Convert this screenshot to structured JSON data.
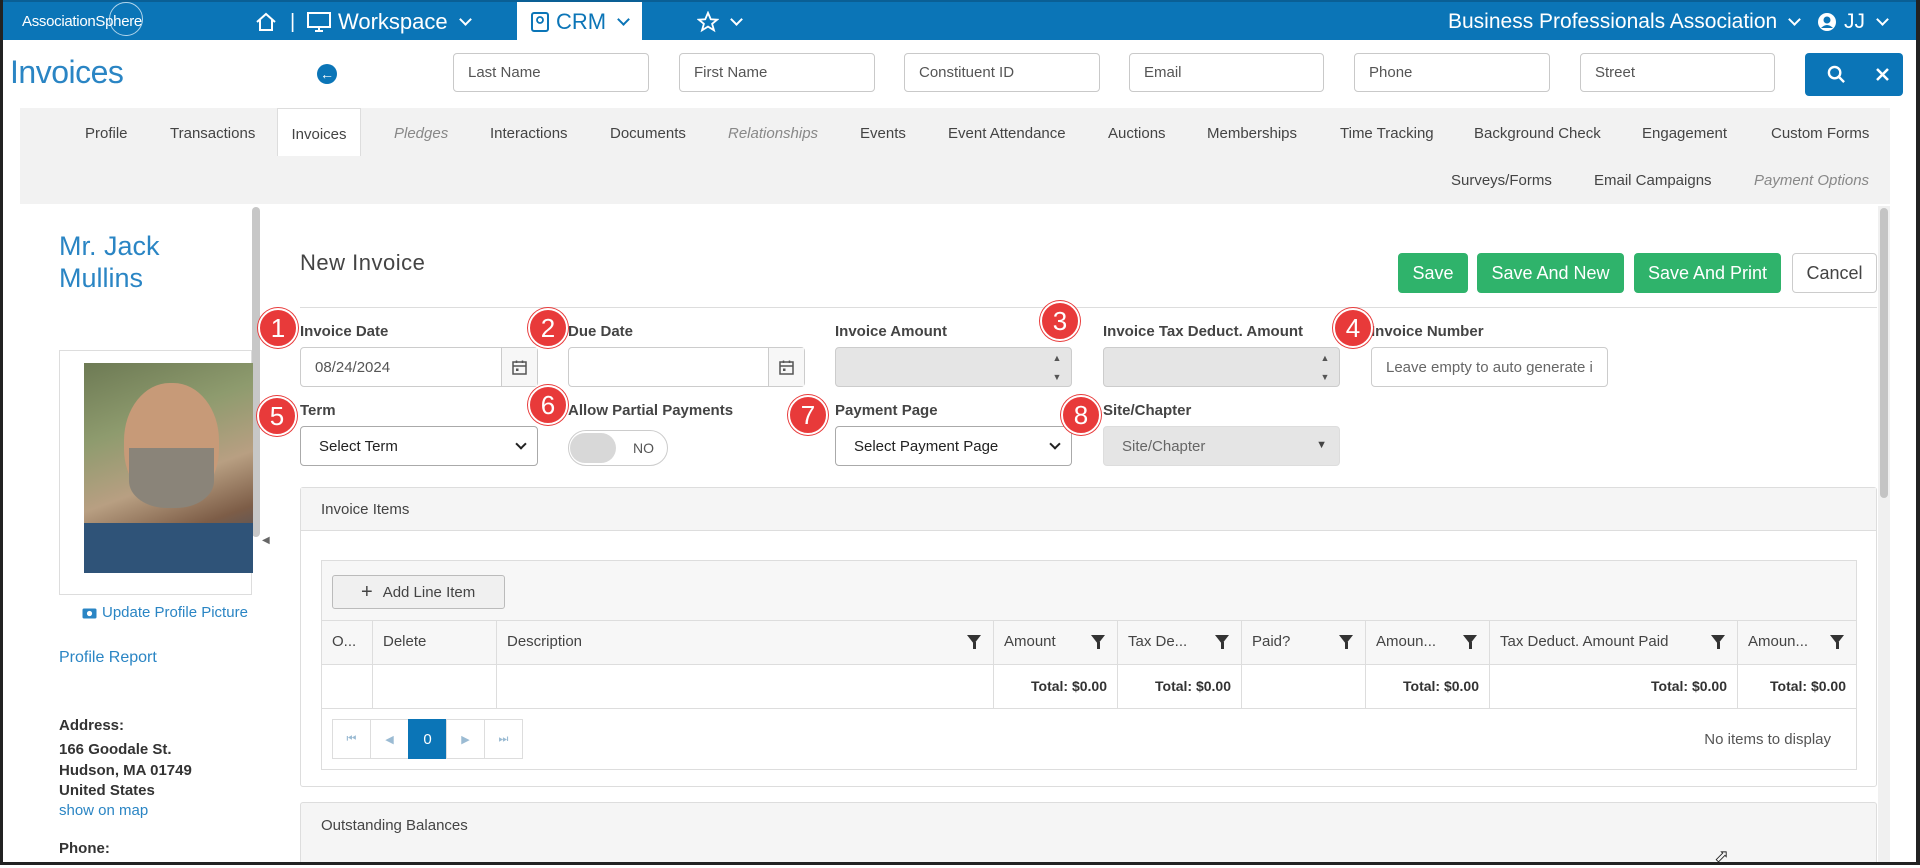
{
  "topbar": {
    "logo": "AssociationSphere",
    "workspace_label": "Workspace",
    "crm_label": "CRM",
    "org_name": "Business Professionals Association",
    "user_initials": "JJ",
    "accent": "#0b75b7"
  },
  "header": {
    "page_title": "Invoices",
    "search_fields": [
      "Last Name",
      "First Name",
      "Constituent ID",
      "Email",
      "Phone",
      "Street"
    ]
  },
  "tabs": [
    {
      "label": "Profile"
    },
    {
      "label": "Transactions"
    },
    {
      "label": "Invoices",
      "active": true
    },
    {
      "label": "Pledges",
      "disabled": true
    },
    {
      "label": "Interactions"
    },
    {
      "label": "Documents"
    },
    {
      "label": "Relationships",
      "disabled": true
    },
    {
      "label": "Events"
    },
    {
      "label": "Event Attendance"
    },
    {
      "label": "Auctions"
    },
    {
      "label": "Memberships"
    },
    {
      "label": "Time Tracking"
    },
    {
      "label": "Background Check"
    },
    {
      "label": "Engagement"
    },
    {
      "label": "Custom Forms"
    },
    {
      "label": "Surveys/Forms"
    },
    {
      "label": "Email Campaigns"
    },
    {
      "label": "Payment Options",
      "disabled": true
    }
  ],
  "profile": {
    "name_line1": "Mr. Jack",
    "name_line2": "Mullins",
    "update_picture": "Update Profile Picture",
    "profile_report": "Profile Report",
    "address_label": "Address:",
    "address_line1": "166 Goodale St.",
    "address_line2": "Hudson, MA 01749",
    "address_line3": "United States",
    "show_on_map": "show on map",
    "phone_label": "Phone:"
  },
  "form": {
    "title": "New Invoice",
    "buttons": {
      "save": "Save",
      "save_new": "Save And New",
      "save_print": "Save And Print",
      "cancel": "Cancel"
    },
    "invoice_date_label": "Invoice Date",
    "invoice_date_value": "08/24/2024",
    "due_date_label": "Due Date",
    "invoice_amount_label": "Invoice Amount",
    "tax_deduct_label": "Invoice Tax Deduct. Amount",
    "invoice_number_label": "Invoice Number",
    "invoice_number_placeholder": "Leave empty to auto generate i",
    "term_label": "Term",
    "term_value": "Select Term",
    "partial_label": "Allow Partial Payments",
    "partial_value": "NO",
    "payment_page_label": "Payment Page",
    "payment_page_value": "Select Payment Page",
    "site_label": "Site/Chapter",
    "site_value": "Site/Chapter",
    "badges": [
      "1",
      "2",
      "3",
      "4",
      "5",
      "6",
      "7",
      "8"
    ]
  },
  "invoice_items": {
    "title": "Invoice Items",
    "add_line": "Add Line Item",
    "columns": [
      "O...",
      "Delete",
      "Description",
      "Amount",
      "Tax De...",
      "Paid?",
      "Amoun...",
      "Tax Deduct. Amount Paid",
      "Amoun..."
    ],
    "totals": [
      "Total: $0.00",
      "Total: $0.00",
      "Total: $0.00",
      "Total: $0.00",
      "Total: $0.00"
    ],
    "page": "0",
    "empty": "No items to display"
  },
  "outstanding": {
    "title": "Outstanding Balances"
  }
}
